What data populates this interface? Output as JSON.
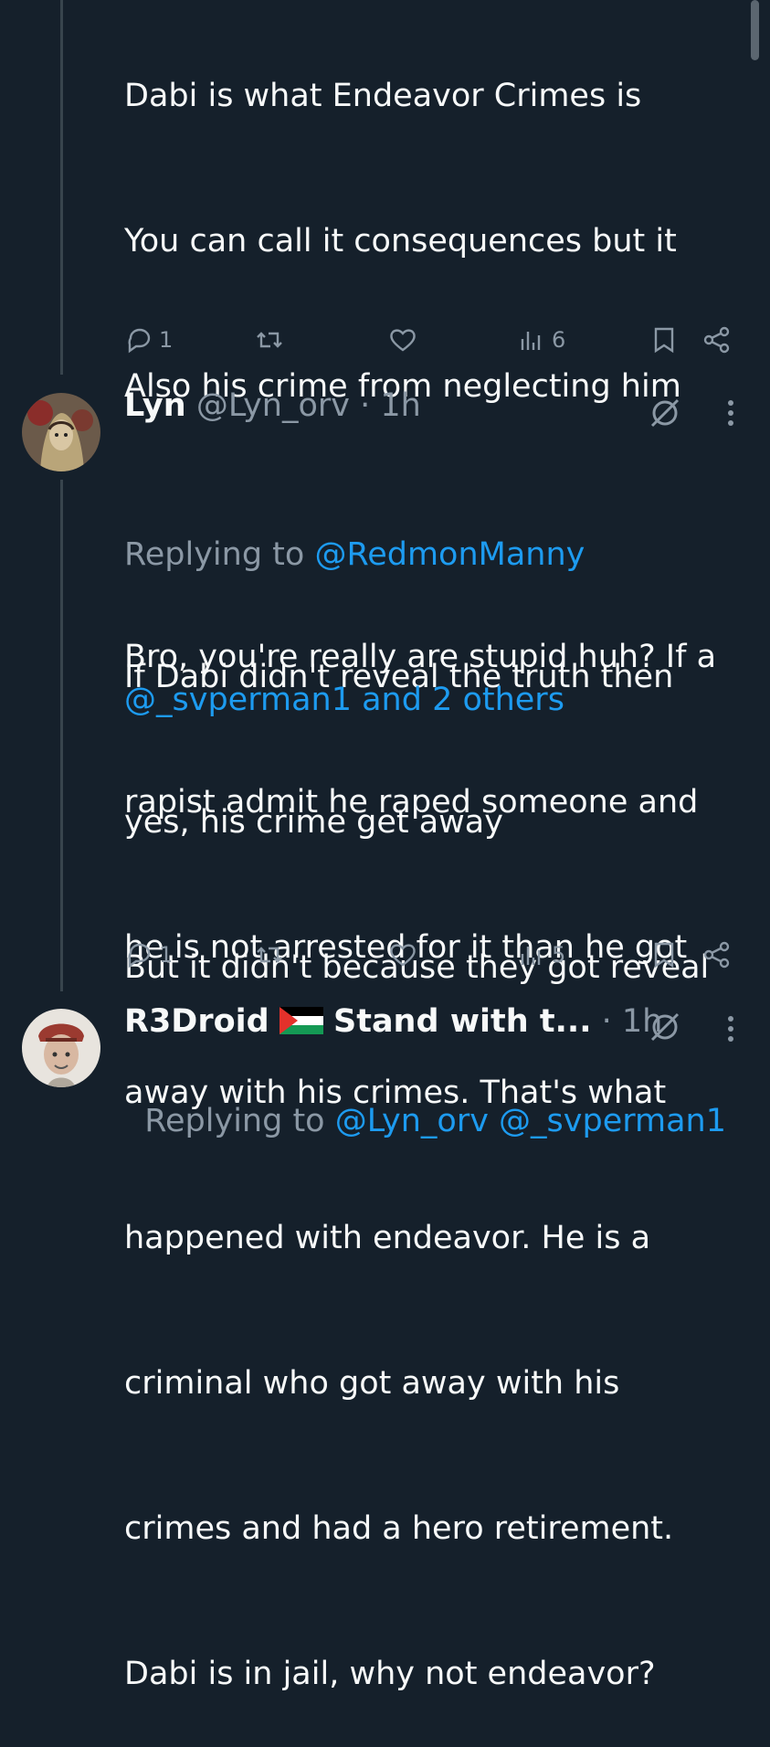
{
  "tweet1": {
    "lines": [
      "Dabi is what Endeavor Crimes is",
      "You can call it consequences but it",
      "Also his crime from neglecting him",
      "",
      "If Dabi didn't reveal the truth then",
      "yes, his crime get away",
      "But it didn't because they got reveal"
    ],
    "stats": {
      "replies": "1",
      "retweets": "",
      "likes": "",
      "views": "6"
    }
  },
  "tweet2": {
    "name": "Lyn",
    "handle": "@Lyn_orv",
    "time": "· 1h",
    "replying_prefix": "Replying to ",
    "replying_to_1": "@RedmonManny",
    "replying_to_2": "@_svperman1 and 2 others",
    "lines": [
      "Bro, you're really are stupid huh? If a",
      "rapist admit he raped someone and",
      "he is not arrested for it than he got",
      "away with his crimes. That's what",
      "happened with endeavor. He is a",
      "criminal who got away with his",
      "crimes and had a hero retirement.",
      "Dabi is in jail, why not endeavor?"
    ],
    "stats": {
      "replies": "1",
      "retweets": "",
      "likes": "",
      "views": "5"
    }
  },
  "tweet3": {
    "name_start": "R3Droid",
    "name_end": "Stand with t...",
    "time": "· 1h",
    "replying_prefix": "Replying to ",
    "replying_to": "@Lyn_orv @_svperman1"
  },
  "icons": [
    "reply-icon",
    "retweet-icon",
    "like-icon",
    "views-icon",
    "bookmark-icon",
    "share-icon",
    "grok-icon",
    "more-icon",
    "palestine-flag-icon"
  ],
  "colors": {
    "background": "#15202b",
    "text": "#f7f9f9",
    "muted": "#8b98a5",
    "link": "#1d9bf0",
    "thread_line": "#38444d"
  }
}
